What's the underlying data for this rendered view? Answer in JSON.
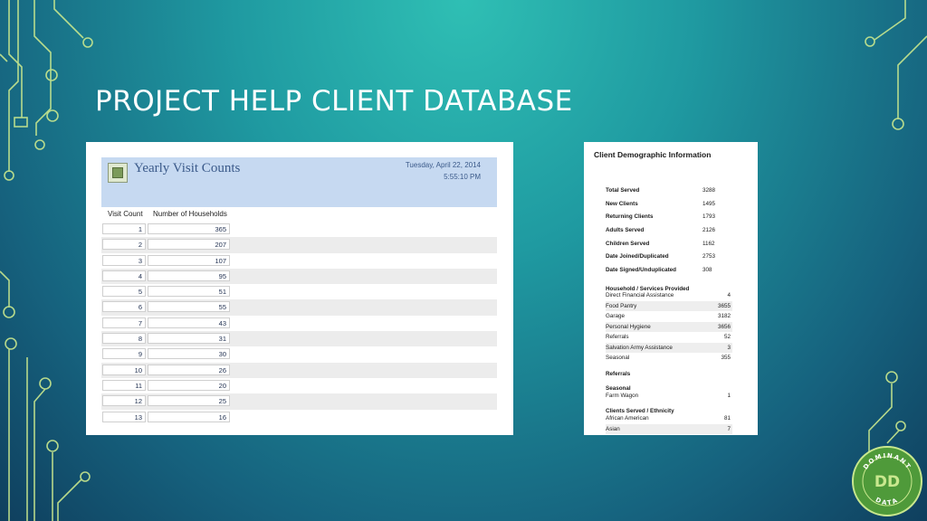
{
  "slide": {
    "title": "PROJECT HELP CLIENT DATABASE"
  },
  "report": {
    "title": "Yearly Visit Counts",
    "date": "Tuesday, April 22, 2014",
    "time": "5:55:10 PM",
    "columns": [
      "Visit Count",
      "Number of Households"
    ],
    "rows": [
      {
        "visit": "1",
        "households": "365"
      },
      {
        "visit": "2",
        "households": "207"
      },
      {
        "visit": "3",
        "households": "107"
      },
      {
        "visit": "4",
        "households": "95"
      },
      {
        "visit": "5",
        "households": "51"
      },
      {
        "visit": "6",
        "households": "55"
      },
      {
        "visit": "7",
        "households": "43"
      },
      {
        "visit": "8",
        "households": "31"
      },
      {
        "visit": "9",
        "households": "30"
      },
      {
        "visit": "10",
        "households": "26"
      },
      {
        "visit": "11",
        "households": "20"
      },
      {
        "visit": "12",
        "households": "25"
      },
      {
        "visit": "13",
        "households": "16"
      }
    ]
  },
  "demographics": {
    "title": "Client Demographic Information",
    "totals": [
      {
        "label": "Total Served",
        "value": "3288"
      },
      {
        "label": "New Clients",
        "value": "1495"
      },
      {
        "label": "Returning Clients",
        "value": "1793"
      },
      {
        "label": "Adults Served",
        "value": "2126"
      },
      {
        "label": "Children Served",
        "value": "1162"
      },
      {
        "label": "Date Joined/Duplicated",
        "value": "2753"
      },
      {
        "label": "Date Signed/Unduplicated",
        "value": "308"
      }
    ],
    "services_title": "Household / Services Provided",
    "services": [
      {
        "label": "Direct Financial Assistance",
        "value": "4"
      },
      {
        "label": "Food Pantry",
        "value": "3655"
      },
      {
        "label": "Garage",
        "value": "3182"
      },
      {
        "label": "Personal Hygiene",
        "value": "3656"
      },
      {
        "label": "Referrals",
        "value": "52"
      },
      {
        "label": "Salvation Army Assistance",
        "value": "3"
      },
      {
        "label": "Seasonal",
        "value": "355"
      }
    ],
    "referrals_title": "Referrals",
    "seasonal_title": "Seasonal",
    "seasonal": [
      {
        "label": "Farm Wagon",
        "value": "1"
      }
    ],
    "ethnicity_title": "Clients Served / Ethnicity",
    "ethnicity": [
      {
        "label": "African American",
        "value": "81"
      },
      {
        "label": "Asian",
        "value": "7"
      }
    ]
  },
  "logo": {
    "top_text": "DOMINANT",
    "bottom_text": "DATA",
    "monogram": "DD"
  },
  "colors": {
    "line": "#c9e88e",
    "panel_header": "#c6d9f1",
    "logo_fill": "#4f9a3a"
  }
}
